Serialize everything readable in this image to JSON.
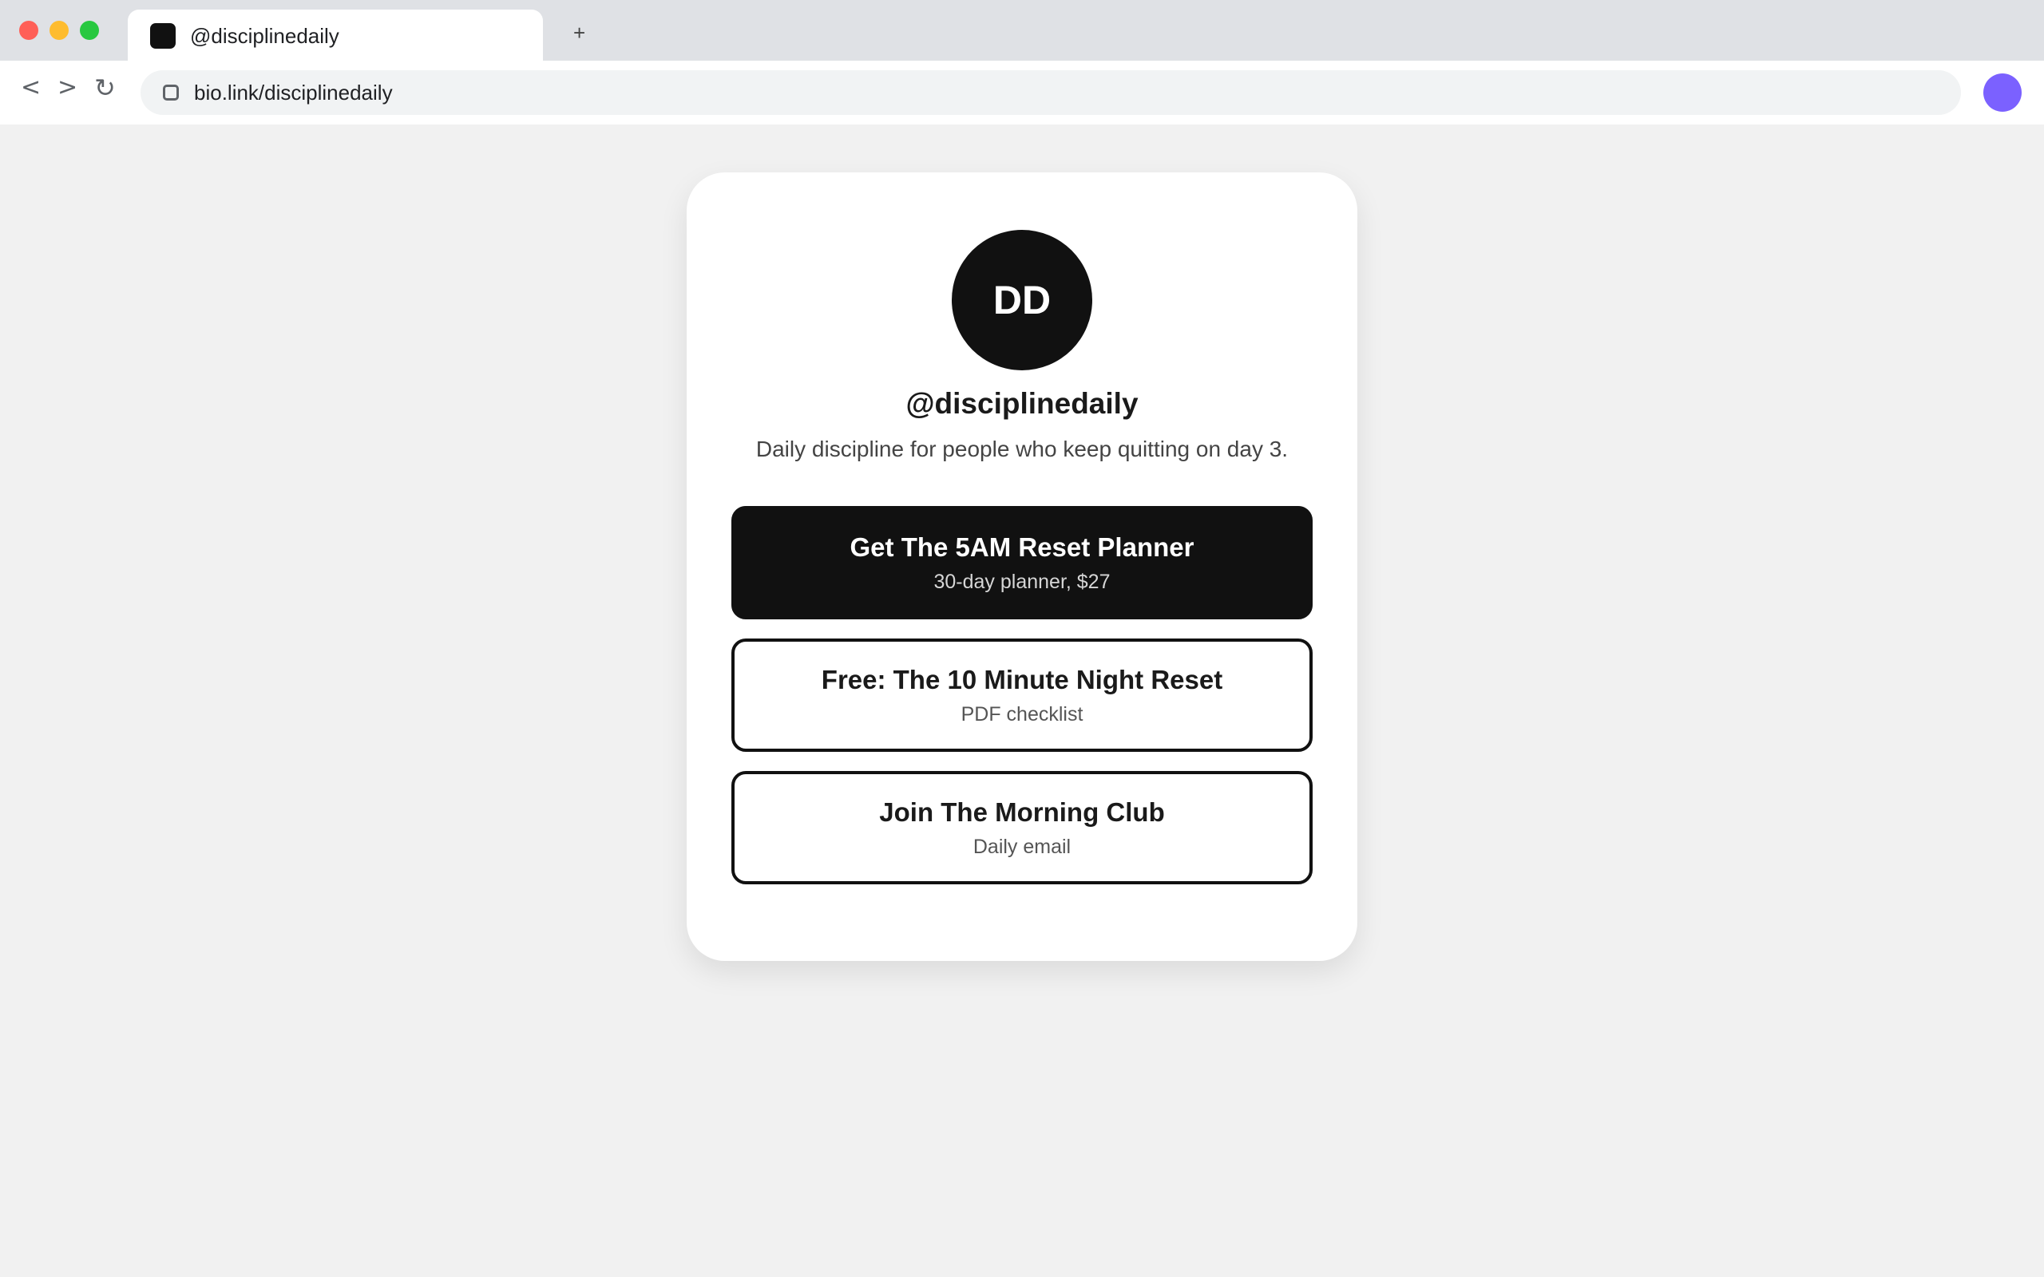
{
  "browser": {
    "tab_title": "@disciplinedaily",
    "new_tab_label": "+",
    "nav": {
      "back": "<",
      "forward": ">",
      "reload": "↻"
    },
    "url": "bio.link/disciplinedaily",
    "colors": {
      "close": "#ff5f57",
      "minimize": "#febc2e",
      "maximize": "#28c840",
      "profile": "#7b61ff"
    }
  },
  "profile": {
    "initials": "DD",
    "handle": "@disciplinedaily",
    "bio": "Daily discipline for people who keep quitting on day 3."
  },
  "links": [
    {
      "title": "Get The 5AM Reset Planner",
      "subtitle": "30-day planner, $27"
    },
    {
      "title": "Free: The 10 Minute Night Reset",
      "subtitle": "PDF checklist"
    },
    {
      "title": "Join The Morning Club",
      "subtitle": "Daily email"
    }
  ]
}
